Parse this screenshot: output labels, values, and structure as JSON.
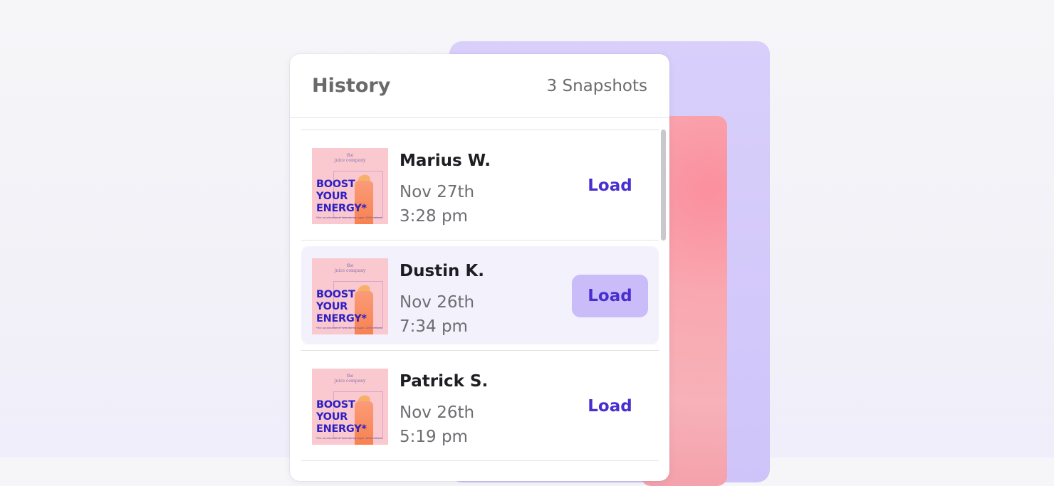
{
  "history": {
    "title": "History",
    "snapshot_count": "3 Snapshots",
    "load_label": "Load",
    "thumbnail": {
      "brand_line1": "the",
      "brand_line2": "juice company",
      "headline_line1": "BOOST",
      "headline_line2": "YOUR",
      "headline_line3": "ENERGY*",
      "fineprint": "*the acceleration of lives during sugar. 100% natural."
    },
    "items": [
      {
        "name": "Marius W.",
        "date": "Nov 27th",
        "time": "3:28 pm",
        "selected": false
      },
      {
        "name": "Dustin K.",
        "date": "Nov 26th",
        "time": "7:34 pm",
        "selected": true
      },
      {
        "name": "Patrick S.",
        "date": "Nov 26th",
        "time": "5:19 pm",
        "selected": false
      }
    ]
  },
  "colors": {
    "accent": "#4a2fd0",
    "selected_button_bg": "#c9bcf9",
    "selected_row_bg": "#f3f1fc",
    "back_card": "#d4c9fa",
    "pink_card": "#f7a3ad"
  }
}
